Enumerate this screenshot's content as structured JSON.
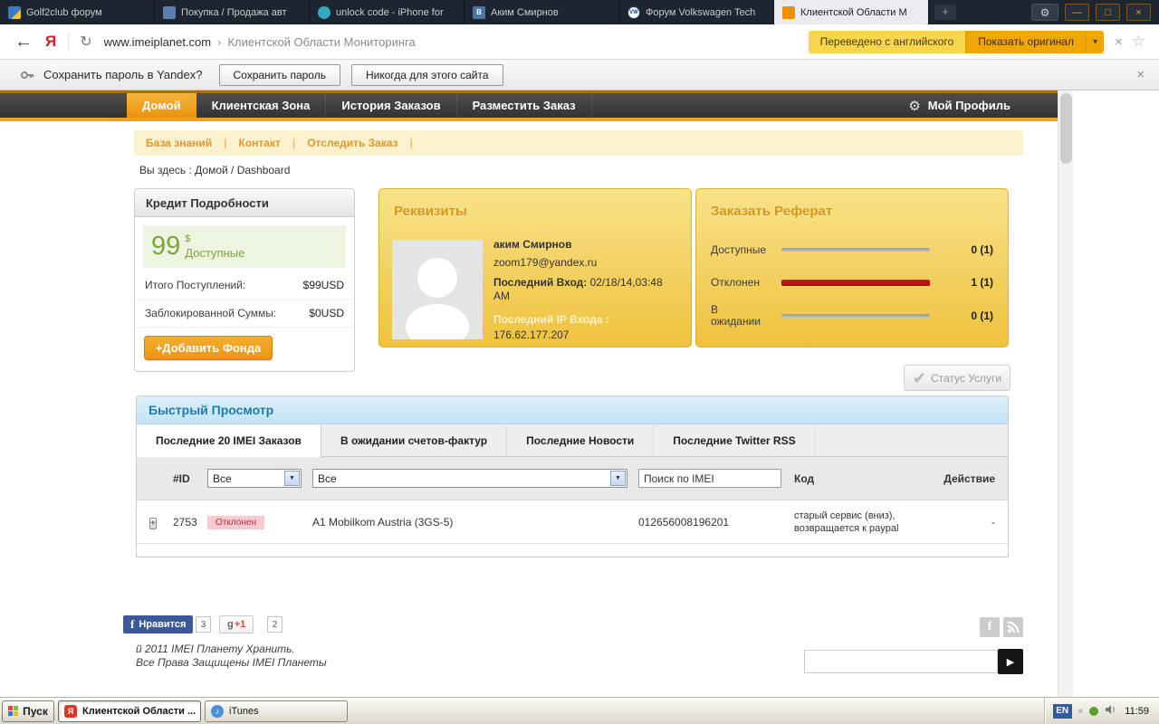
{
  "colors": {
    "accent_orange": "#efa018",
    "translate_yellow": "#f7d64d",
    "translate_orange": "#f0a705",
    "rejected_red": "#c51111",
    "progress_gray": "#9f9f9f",
    "panel_blue": "#1d7ab2",
    "credit_green": "#79a73e"
  },
  "icons": {
    "new_tab": "+",
    "gear": "⚙",
    "minimize": "—",
    "maximize": "□",
    "close": "×",
    "back": "←",
    "reload": "↻",
    "dropdown": "▾",
    "star": "☆",
    "check": "✔",
    "select_arrow": "▼",
    "expand": "+",
    "facebook_f": "f",
    "arrow_right": "▶",
    "chevron_left": "«"
  },
  "browser": {
    "tabs": [
      {
        "title": "Golf2club форум"
      },
      {
        "title": "Покупка / Продажа авт"
      },
      {
        "title": "unlock code - iPhone for"
      },
      {
        "title": "Аким Смирнов",
        "fav": "В"
      },
      {
        "title": "Форум Volkswagen Tech",
        "fav": "VW"
      },
      {
        "title": "Клиентской Области М"
      }
    ],
    "address": {
      "logo": "Я",
      "host": "www.imeiplanet.com",
      "separator": "›",
      "page_title": "Клиентской Области Мониторинга",
      "translated_button": "Переведено с английского",
      "original_button": "Показать оригинал"
    },
    "password_bar": {
      "prompt": "Сохранить пароль в Yandex?",
      "save": "Сохранить пароль",
      "never": "Никогда для этого сайта"
    }
  },
  "site": {
    "nav": {
      "items": [
        {
          "label": "Домой"
        },
        {
          "label": "Клиентская Зона"
        },
        {
          "label": "История Заказов"
        },
        {
          "label": "Разместить Заказ"
        }
      ],
      "profile": "Мой Профиль"
    },
    "subnav": [
      {
        "label": "База знаний"
      },
      {
        "label": "Контакт"
      },
      {
        "label": "Отследить Заказ"
      }
    ],
    "subnav_divider": "|",
    "breadcrumb": "Вы здесь : Домой / Dashboard",
    "credit": {
      "title": "Кредит Подробности",
      "amount": "99",
      "currency": "$",
      "available": "Доступные",
      "row1_label": "Итого Поступлений:",
      "row1_value": "$99USD",
      "row2_label": "Заблокированной Суммы:",
      "row2_value": "$0USD",
      "add_button": "+Добавить Фонда"
    },
    "account": {
      "title": "Реквизиты",
      "name": "аким Смирнов",
      "email": "zoom179@yandex.ru",
      "last_login_label": "Последний Вход:",
      "last_login_value": "02/18/14,03:48 AM",
      "last_ip_label": "Последний IP Входа :",
      "last_ip_value": "176.62.177.207"
    },
    "orders": {
      "title": "Заказать Реферат",
      "rows": [
        {
          "label": "Доступные",
          "value": "0 (1)",
          "bar_color": "#9f9f9f"
        },
        {
          "label": "Отклонен",
          "value": "1 (1)",
          "bar_color": "#c51111"
        },
        {
          "label": "В ожидании",
          "value": "0 (1)",
          "bar_color": "#9f9f9f"
        }
      ]
    },
    "status_button": "Статус Услуги",
    "quick_view": {
      "title": "Быстрый Просмотр",
      "tabs": [
        {
          "label": "Последние 20 IMEI Заказов"
        },
        {
          "label": "В ожидании счетов-фактур"
        },
        {
          "label": "Последние Новости"
        },
        {
          "label": "Последние Twitter RSS"
        }
      ],
      "header": {
        "id": "#ID",
        "status_filter": "Все",
        "service_filter": "Все",
        "imei_search": "Поиск по IMEI",
        "code": "Код",
        "action": "Действие"
      },
      "row": {
        "id": "2753",
        "status": "Отклонен",
        "service": "A1 Mobilkom Austria (3GS-5)",
        "imei": "012656008196201",
        "code_line1": "старый сервис (вниз),",
        "code_line2": "возвращается к paypal",
        "action": "-"
      }
    },
    "footer": {
      "fb_like": "Нравится",
      "fb_count": "3",
      "gplus_g": "g",
      "gplus_plus": "+1",
      "gplus_count": "2",
      "copyright_line1": "й 2011 IMEI Планету Хранить.",
      "copyright_line2": "Все Права Защищены IMEI Планеты"
    }
  },
  "taskbar": {
    "start": "Пуск",
    "tasks": [
      {
        "label": "Клиентской Области ...",
        "glyph": "Я"
      },
      {
        "label": "iTunes",
        "glyph": "♪"
      }
    ],
    "tray": {
      "lang": "EN",
      "clock": "11:59"
    }
  }
}
